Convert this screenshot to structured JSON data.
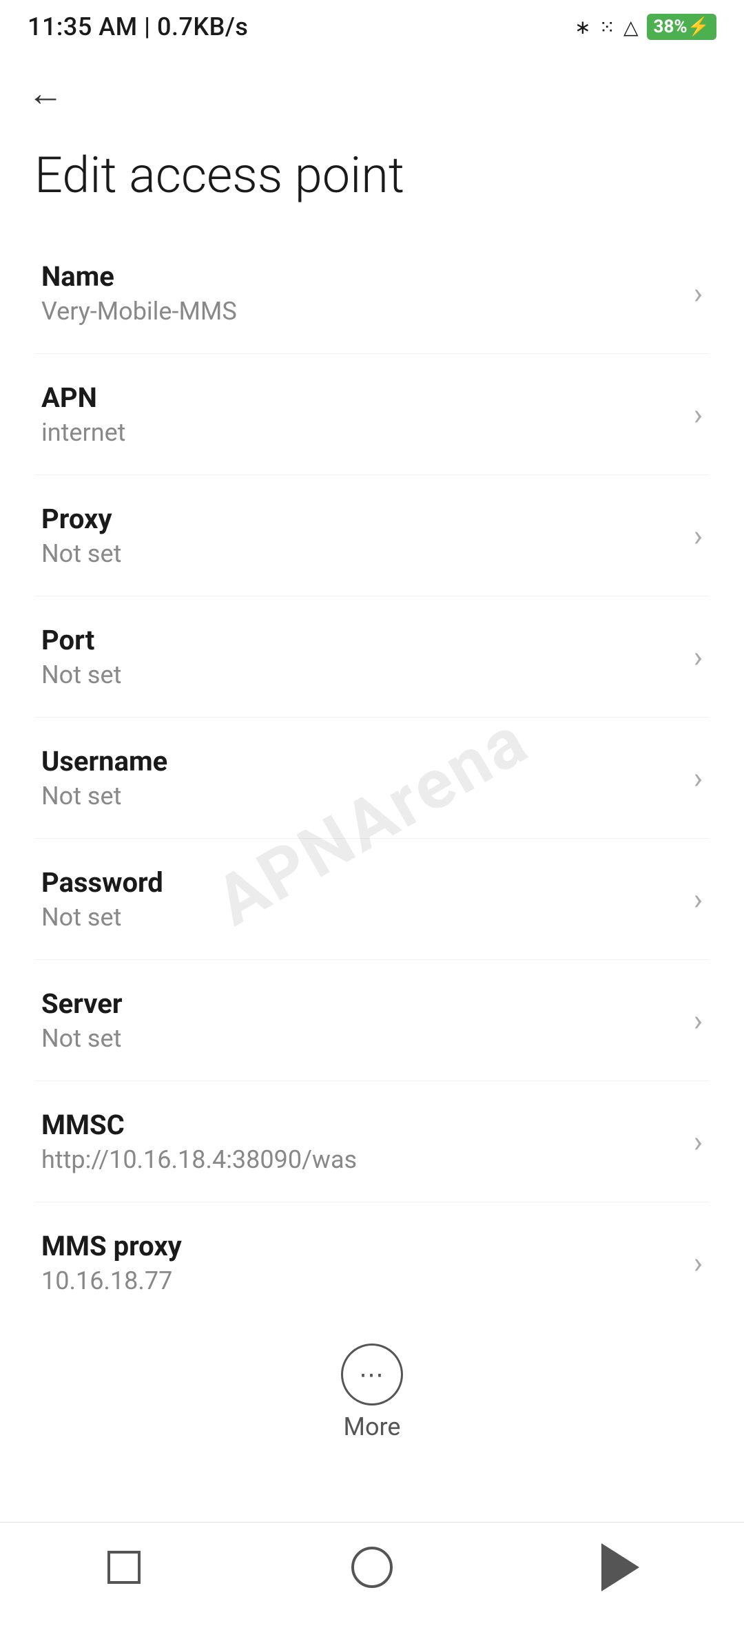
{
  "statusBar": {
    "time": "11:35 AM | 0.7KB/s",
    "battery": "38"
  },
  "navigation": {
    "backLabel": "←"
  },
  "page": {
    "title": "Edit access point"
  },
  "settings": [
    {
      "label": "Name",
      "value": "Very-Mobile-MMS"
    },
    {
      "label": "APN",
      "value": "internet"
    },
    {
      "label": "Proxy",
      "value": "Not set"
    },
    {
      "label": "Port",
      "value": "Not set"
    },
    {
      "label": "Username",
      "value": "Not set"
    },
    {
      "label": "Password",
      "value": "Not set"
    },
    {
      "label": "Server",
      "value": "Not set"
    },
    {
      "label": "MMSC",
      "value": "http://10.16.18.4:38090/was"
    },
    {
      "label": "MMS proxy",
      "value": "10.16.18.77"
    }
  ],
  "more": {
    "label": "More"
  },
  "watermark": {
    "text": "APNArena"
  }
}
